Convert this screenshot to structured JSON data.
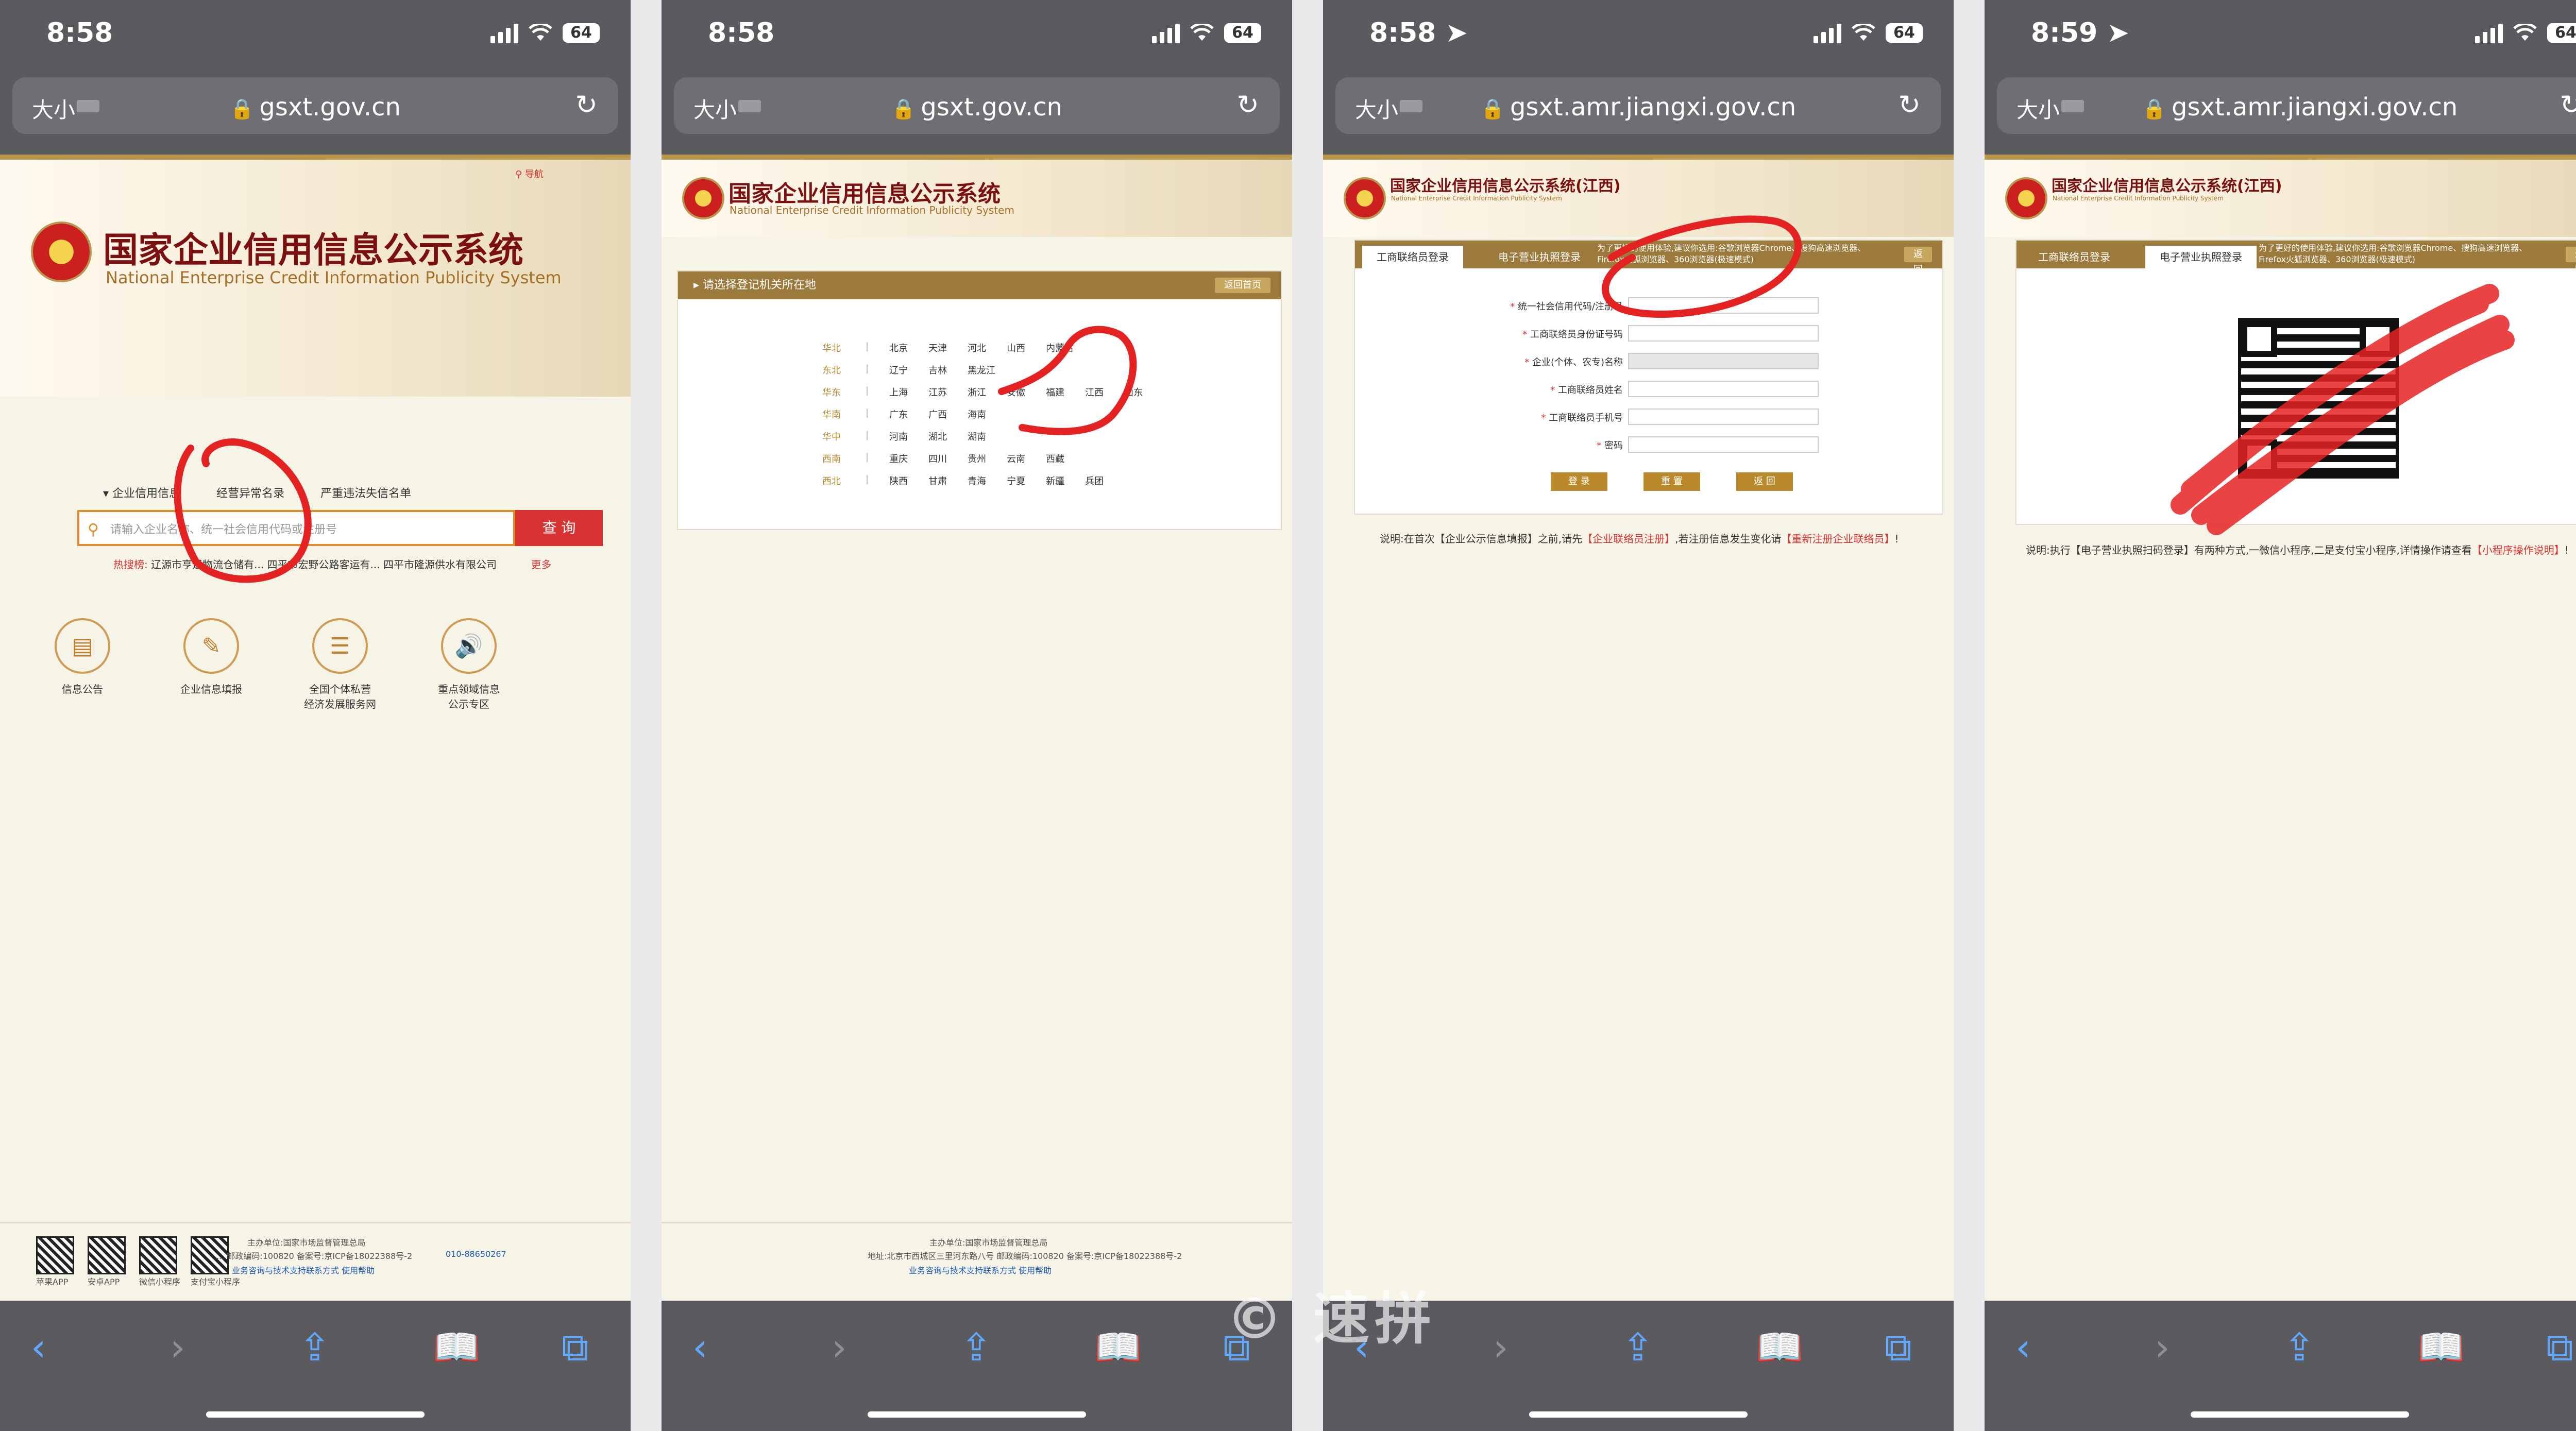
{
  "panels": [
    {
      "time": "8:58",
      "location_arrow": false,
      "url": "gsxt.gov.cn"
    },
    {
      "time": "8:58",
      "location_arrow": false,
      "url": "gsxt.gov.cn"
    },
    {
      "time": "8:58",
      "location_arrow": true,
      "url": "gsxt.amr.jiangxi.gov.cn"
    },
    {
      "time": "8:59",
      "location_arrow": true,
      "url": "gsxt.amr.jiangxi.gov.cn"
    }
  ],
  "browser": {
    "text_size_label": "大小",
    "battery": "64"
  },
  "site": {
    "title_cn": "国家企业信用信息公示系统",
    "title_en": "National Enterprise Credit Information Publicity System",
    "title_cn_jx": "国家企业信用信息公示系统(江西)",
    "nav_link": "导航",
    "tabs": [
      "企业信用信息",
      "经营异常名录",
      "严重违法失信名单"
    ],
    "search_placeholder": "请输入企业名称、统一社会信用代码或注册号",
    "search_button": "查 询",
    "hot_label": "热搜榜:",
    "hot_items": "辽源市亨通物流仓储有...    四平市宏野公路客运有...    四平市隆源供水有限公司",
    "hot_more": "更多",
    "icons": [
      {
        "label": "信息公告",
        "icon": "document-icon"
      },
      {
        "label": "企业信息填报",
        "icon": "edit-icon"
      },
      {
        "label": "全国个体私营\n经济发展服务网",
        "icon": "list-icon"
      },
      {
        "label": "重点领域信息\n公示专区",
        "icon": "speaker-icon"
      }
    ],
    "footer": {
      "host": "主办单位:国家市场监督管理总局",
      "address": "地址:北京市西城区三里河东路八号    邮政编码:100820    备案号:京ICP备18022388号-2",
      "address_short": "...    邮政编码:100820    备案号:京ICP备18022388号-2",
      "support": "业务咨询与技术支持联系方式    使用帮助",
      "phone": "010-88650267",
      "apps": [
        "苹果APP",
        "安卓APP",
        "微信小程序",
        "支付宝小程序"
      ]
    }
  },
  "region": {
    "header": "请选择登记机关所在地",
    "back": "返回首页",
    "rows": [
      {
        "zone": "华北",
        "items": [
          "北京",
          "天津",
          "河北",
          "山西",
          "内蒙古"
        ]
      },
      {
        "zone": "东北",
        "items": [
          "辽宁",
          "吉林",
          "黑龙江"
        ]
      },
      {
        "zone": "华东",
        "items": [
          "上海",
          "江苏",
          "浙江",
          "安徽",
          "福建",
          "江西",
          "山东"
        ]
      },
      {
        "zone": "华南",
        "items": [
          "广东",
          "广西",
          "海南"
        ]
      },
      {
        "zone": "华中",
        "items": [
          "河南",
          "湖北",
          "湖南"
        ]
      },
      {
        "zone": "西南",
        "items": [
          "重庆",
          "四川",
          "贵州",
          "云南",
          "西藏"
        ]
      },
      {
        "zone": "西北",
        "items": [
          "陕西",
          "甘肃",
          "青海",
          "宁夏",
          "新疆",
          "兵团"
        ]
      }
    ]
  },
  "login": {
    "tab_liaison": "工商联络员登录",
    "tab_license": "电子营业执照登录",
    "tip": "为了更好的使用体验,建议你选用:谷歌浏览器Chrome、搜狗高速浏览器、Firefox火狐浏览器、360浏览器(极速模式)",
    "back": "返回首页",
    "fields": [
      {
        "label": "统一社会信用代码/注册号",
        "disabled": false
      },
      {
        "label": "工商联络员身份证号码",
        "disabled": false
      },
      {
        "label": "企业(个体、农专)名称",
        "disabled": true
      },
      {
        "label": "工商联络员姓名",
        "disabled": false
      },
      {
        "label": "工商联络员手机号",
        "disabled": false
      },
      {
        "label": "密码",
        "disabled": false
      }
    ],
    "buttons": [
      "登 录",
      "重 置",
      "返 回"
    ],
    "note_prefix": "说明:在首次【企业公示信息填报】之前,请先",
    "note_link1": "【企业联络员注册】",
    "note_mid": ",若注册信息发生变化请",
    "note_link2": "【重新注册企业联络员】",
    "note_suffix": "!"
  },
  "qr_login": {
    "note_prefix": "说明:执行【电子营业执照扫码登录】有两种方式,一微信小程序,二是支付宝小程序,详情操作请查看",
    "note_link": "【小程序操作说明】",
    "note_suffix": "!"
  },
  "watermark": "© 速拼"
}
